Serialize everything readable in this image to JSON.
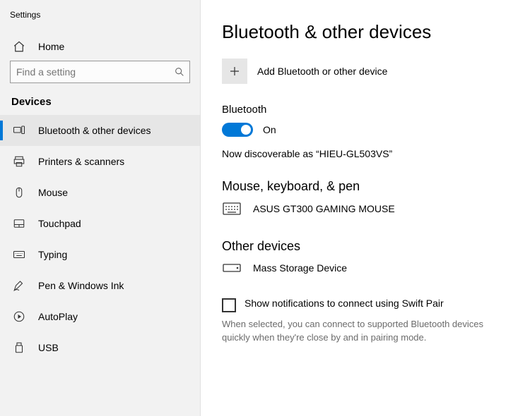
{
  "app_title": "Settings",
  "home_label": "Home",
  "search_placeholder": "Find a setting",
  "section_header": "Devices",
  "sidebar": {
    "items": [
      {
        "label": "Bluetooth & other devices",
        "selected": true
      },
      {
        "label": "Printers & scanners"
      },
      {
        "label": "Mouse"
      },
      {
        "label": "Touchpad"
      },
      {
        "label": "Typing"
      },
      {
        "label": "Pen & Windows Ink"
      },
      {
        "label": "AutoPlay"
      },
      {
        "label": "USB"
      }
    ]
  },
  "page_title": "Bluetooth & other devices",
  "add_device_label": "Add Bluetooth or other device",
  "bluetooth": {
    "heading": "Bluetooth",
    "state_label": "On",
    "enabled": true,
    "discoverable_text": "Now discoverable as “HIEU-GL503VS”"
  },
  "groups": {
    "mouse_kb": {
      "title": "Mouse, keyboard, & pen",
      "devices": [
        {
          "name": "ASUS GT300 GAMING MOUSE",
          "kind": "keyboard"
        }
      ]
    },
    "other": {
      "title": "Other devices",
      "devices": [
        {
          "name": "Mass Storage Device",
          "kind": "storage"
        }
      ]
    }
  },
  "swift_pair": {
    "label": "Show notifications to connect using Swift Pair",
    "checked": false,
    "help": "When selected, you can connect to supported Bluetooth devices quickly when they're close by and in pairing mode."
  }
}
